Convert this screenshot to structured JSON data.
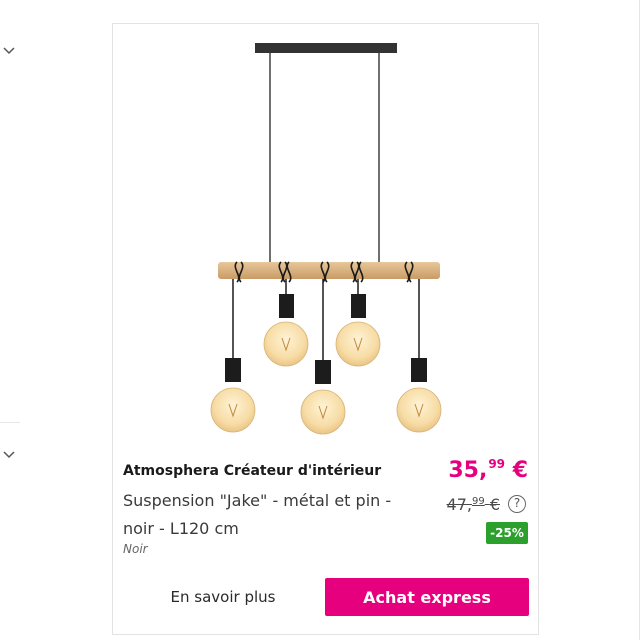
{
  "product": {
    "brand": "Atmosphera Créateur d'intérieur",
    "title": "Suspension \"Jake\" - métal et pin - noir - L120 cm",
    "variant": "Noir",
    "price": {
      "main": "35,",
      "cents": "99",
      "currency": "€"
    },
    "old_price": {
      "main": "47,",
      "cents": "99",
      "currency": "€"
    },
    "help_symbol": "?",
    "discount": "-25%"
  },
  "actions": {
    "learn_more": "En savoir plus",
    "buy_express": "Achat express"
  },
  "colors": {
    "accent": "#e6007e",
    "discount": "#2ca02c"
  },
  "icons": {
    "left_chevrons": [
      "chevron-down-icon",
      "chevron-down-icon"
    ],
    "help": "question-circle-icon"
  }
}
